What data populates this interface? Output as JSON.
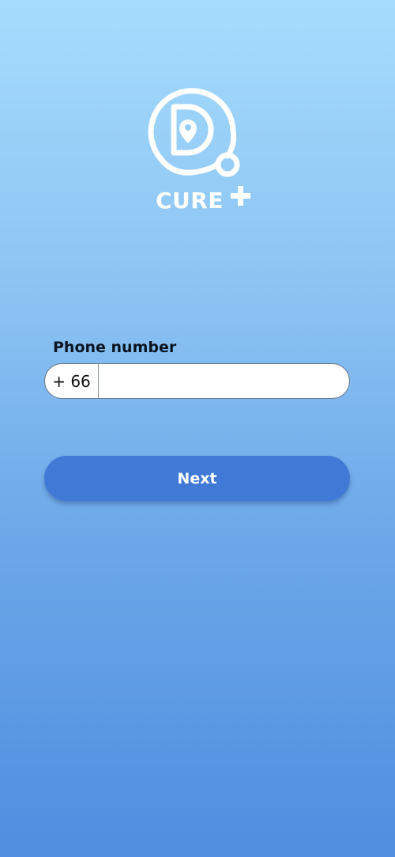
{
  "brand": {
    "name": "CURE",
    "logo_icon": "stethoscope-location-pin-logo",
    "plus_icon": "plus-icon"
  },
  "phone": {
    "label": "Phone number",
    "country_code": "+ 66",
    "value": "",
    "placeholder": ""
  },
  "actions": {
    "next_label": "Next"
  },
  "colors": {
    "gradient_top": "#a6dcfd",
    "gradient_bottom": "#4f8ee0",
    "button": "#4179d7",
    "logo": "#ffffff"
  }
}
